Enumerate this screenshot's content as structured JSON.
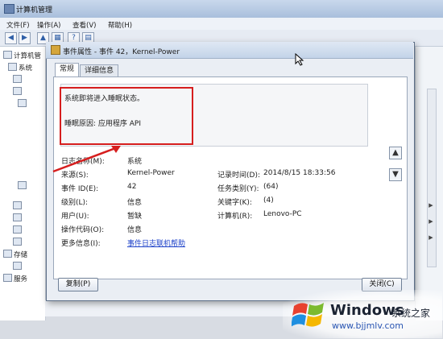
{
  "background_window": {
    "title": "计算机管理",
    "menu": [
      "文件(F)",
      "操作(A)",
      "查看(V)",
      "帮助(H)"
    ],
    "tree_items": [
      "计算机管",
      "系统",
      "存储",
      "服务"
    ]
  },
  "dialog": {
    "title": "事件属性 - 事件 42，Kernel-Power",
    "tabs": [
      {
        "label": "常规",
        "active": true
      },
      {
        "label": "详细信息",
        "active": false
      }
    ],
    "message_line1": "系统即将进入睡眠状态。",
    "message_line2": "睡眠原因: 应用程序 API",
    "fields": {
      "log_name_label": "日志名称(M):",
      "log_name_value": "系统",
      "source_label": "来源(S):",
      "source_value": "Kernel-Power",
      "logged_label": "记录时间(D):",
      "logged_value": "2014/8/15 18:33:56",
      "event_id_label": "事件 ID(E):",
      "event_id_value": "42",
      "task_category_label": "任务类别(Y):",
      "task_category_value": "(64)",
      "level_label": "级别(L):",
      "level_value": "信息",
      "keywords_label": "关键字(K):",
      "keywords_value": "(4)",
      "user_label": "用户(U):",
      "user_value": "暂缺",
      "computer_label": "计算机(R):",
      "computer_value": "Lenovo-PC",
      "opcode_label": "操作代码(O):",
      "opcode_value": "信息",
      "more_info_label": "更多信息(I):",
      "more_info_link": "事件日志联机帮助"
    },
    "copy_button": "复制(P)",
    "close_button": "关闭(C)"
  },
  "watermark": {
    "brand": "Windows",
    "cn": "系统之家",
    "url": "www.bjjmlv.com"
  },
  "colors": {
    "annotation_red": "#d61e1e",
    "link_blue": "#1a3fc8"
  }
}
